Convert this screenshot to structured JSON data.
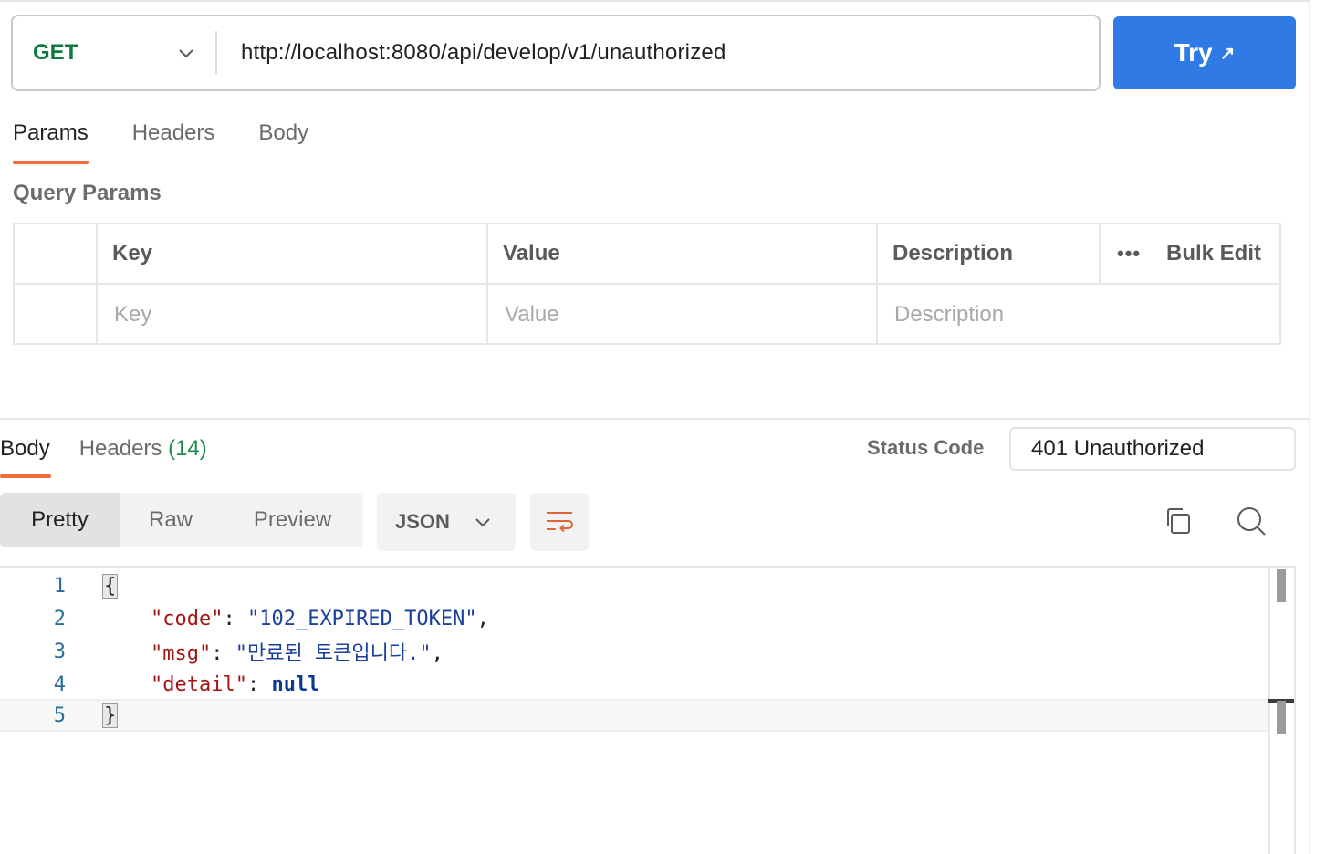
{
  "request": {
    "method": "GET",
    "url": "http://localhost:8080/api/develop/v1/unauthorized",
    "try_label": "Try",
    "try_arrow": "↗"
  },
  "request_tabs": [
    {
      "label": "Params",
      "active": true
    },
    {
      "label": "Headers",
      "active": false
    },
    {
      "label": "Body",
      "active": false
    }
  ],
  "query_params": {
    "section_label": "Query Params",
    "columns": {
      "key": "Key",
      "value": "Value",
      "description": "Description"
    },
    "more_label": "•••",
    "bulk_edit_label": "Bulk Edit",
    "placeholders": {
      "key": "Key",
      "value": "Value",
      "description": "Description"
    }
  },
  "response_tabs": {
    "body": "Body",
    "headers": "Headers",
    "headers_count": "(14)"
  },
  "status": {
    "label": "Status Code",
    "value": "401 Unauthorized"
  },
  "view_modes": [
    "Pretty",
    "Raw",
    "Preview"
  ],
  "active_view": "Pretty",
  "format": "JSON",
  "code": {
    "line_numbers": [
      "1",
      "2",
      "3",
      "4",
      "5"
    ],
    "open_brace": "{",
    "close_brace": "}",
    "code_key": "\"code\"",
    "code_value": "\"102_EXPIRED_TOKEN\"",
    "msg_key": "\"msg\"",
    "msg_value": "\"만료된 토큰입니다.\"",
    "detail_key": "\"detail\"",
    "detail_value": "null"
  },
  "colors": {
    "accent": "#ef6c3a",
    "primary_button": "#2f7ae5",
    "method_get": "#0e7a3a"
  }
}
